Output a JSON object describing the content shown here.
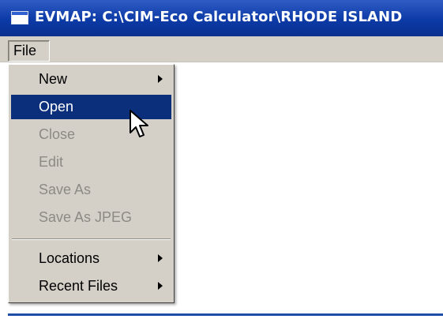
{
  "window": {
    "title": "EVMAP: C:\\CIM-Eco Calculator\\RHODE ISLAND",
    "icon": "app-window-icon"
  },
  "menubar": {
    "items": [
      {
        "label": "File",
        "state": "open"
      }
    ]
  },
  "file_menu": {
    "items": [
      {
        "label": "New",
        "enabled": true,
        "submenu": true
      },
      {
        "label": "Open",
        "enabled": true,
        "highlighted": true
      },
      {
        "label": "Close",
        "enabled": false
      },
      {
        "label": "Edit",
        "enabled": false
      },
      {
        "label": "Save As",
        "enabled": false
      },
      {
        "label": "Save As JPEG",
        "enabled": false
      },
      {
        "label": "Locations",
        "enabled": true,
        "submenu": true
      },
      {
        "label": "Recent Files",
        "enabled": true,
        "submenu": true
      }
    ],
    "separator_after_index": 5
  },
  "colors": {
    "titlebar": "#0c3aa6",
    "menu_background": "#d4d0c8",
    "highlight": "#0c2f7c",
    "disabled_text": "#8c8a84"
  },
  "cursor": {
    "icon": "arrow-pointer-icon"
  }
}
